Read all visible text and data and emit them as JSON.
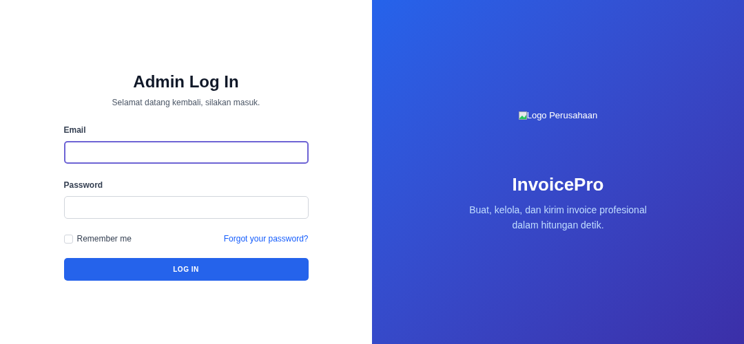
{
  "login": {
    "title": "Admin Log In",
    "subtitle": "Selamat datang kembali, silakan masuk.",
    "fields": [
      {
        "label": "Email",
        "focused": true
      },
      {
        "label": "Password",
        "focused": false
      }
    ],
    "remember": {
      "label": "Remember me",
      "checked": false
    },
    "forgot_link": "Forgot your password?",
    "submit": "LOG IN"
  },
  "brand": {
    "logo_alt": "Logo Perusahaan",
    "name": "InvoicePro",
    "tagline": "Buat, kelola, dan kirim invoice profesional dalam hitungan detik."
  }
}
